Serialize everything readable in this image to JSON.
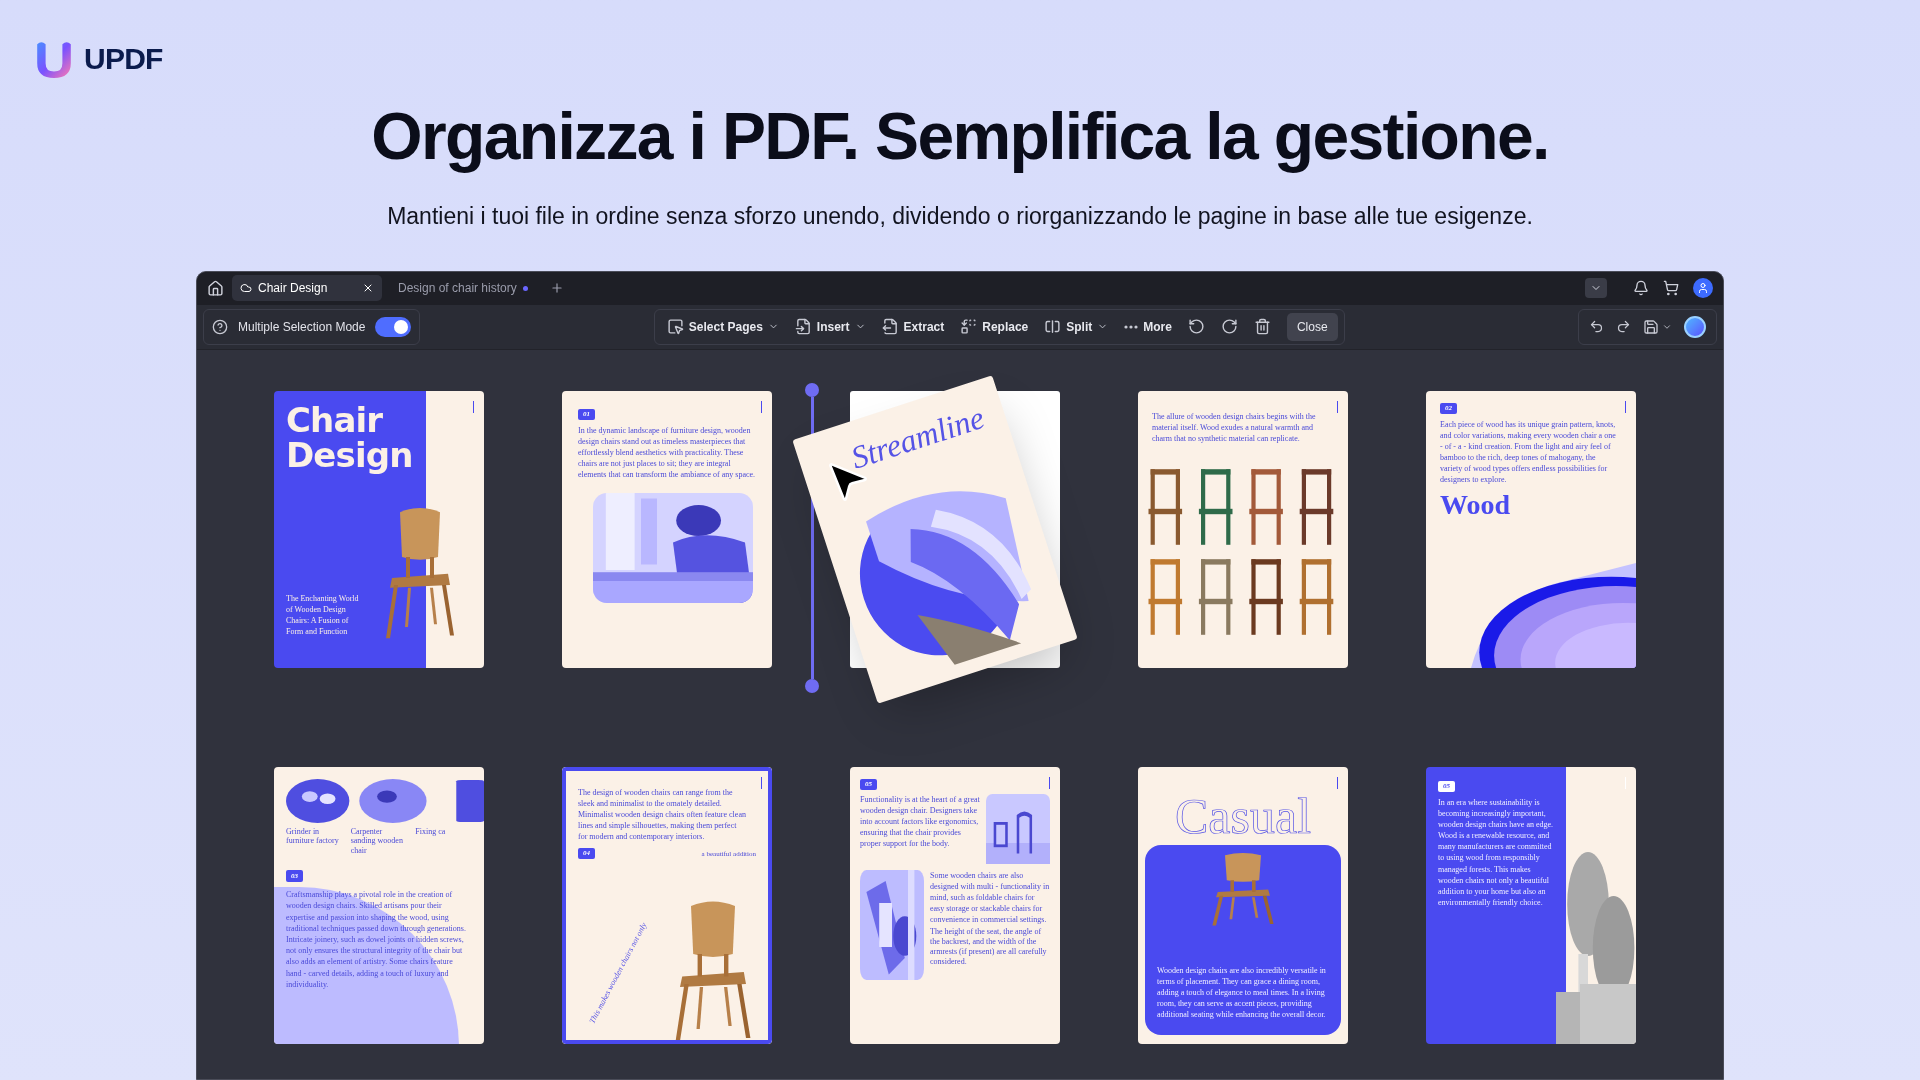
{
  "brand": {
    "name": "UPDF"
  },
  "headline": "Organizza i PDF. Semplifica la gestione.",
  "subtitle": "Mantieni i tuoi file in ordine senza sforzo unendo, dividendo o riorganizzando le pagine in base alle tue esigenze.",
  "tabs": [
    {
      "label": "Chair Design",
      "selected": true,
      "cloud": true,
      "unsaved": false
    },
    {
      "label": "Design of chair history",
      "selected": false,
      "cloud": false,
      "unsaved": true
    }
  ],
  "multi_select": {
    "label": "Multiple Selection Mode",
    "on": true
  },
  "tools": [
    {
      "label": "Select Pages",
      "dropdown": true
    },
    {
      "label": "Insert",
      "dropdown": true
    },
    {
      "label": "Extract",
      "dropdown": false
    },
    {
      "label": "Replace",
      "dropdown": false
    },
    {
      "label": "Split",
      "dropdown": true
    },
    {
      "label": "More",
      "dropdown": false
    }
  ],
  "close_label": "Close",
  "pages": [
    {
      "kind": "cover",
      "selected": false,
      "title": [
        "Chair",
        "Design"
      ],
      "text": "The Enchanting World of Wooden Design Chairs: A Fusion of Form and Function"
    },
    {
      "kind": "intro",
      "selected": false,
      "badge": "01",
      "text": "In the dynamic landscape of furniture design, wooden design chairs stand out as timeless masterpieces that effortlessly blend aesthetics with practicality. These chairs are not just places to sit; they are integral elements that can transform the ambiance of any space."
    },
    {
      "kind": "dragged",
      "selected": false,
      "title": "Streamline"
    },
    {
      "kind": "gallery",
      "selected": false,
      "text": "The allure of wooden design chairs begins with the material itself. Wood exudes a natural warmth and charm that no synthetic material can replicate."
    },
    {
      "kind": "wood",
      "selected": false,
      "badge": "02",
      "text": "Each piece of wood has its unique grain pattern, knots, and color variations, making every wooden chair a one - of - a - kind creation. From the light and airy feel of bamboo to the rich, deep tones of mahogany, the variety of wood types offers endless possibilities for designers to explore.",
      "title": "Wood"
    },
    {
      "kind": "craft",
      "selected": false,
      "captions": [
        "Grinder in furniture factory",
        "Carpenter sanding wooden chair",
        "Fixing ca"
      ],
      "badge": "03",
      "text": "Craftsmanship plays a pivotal role in the creation of wooden design chairs. Skilled artisans pour their expertise and passion into shaping the wood, using traditional techniques passed down through generations. Intricate joinery, such as dowel joints or hidden screws, not only ensures the structural integrity of the chair but also adds an element of artistry. Some chairs feature hand - carved details, adding a touch of luxury and individuality."
    },
    {
      "kind": "design",
      "selected": true,
      "text": "The design of wooden chairs can range from the sleek and minimalist to the ornately detailed. Minimalist wooden design chairs often feature clean lines and simple silhouettes, making them perfect for modern and contemporary interiors.",
      "badge": "04",
      "note": "a beautiful addition",
      "curve": "This makes wooden chairs not only"
    },
    {
      "kind": "function",
      "selected": false,
      "badge": "05",
      "text": "Functionality is at the heart of a great wooden design chair. Designers take into account factors like ergonomics, ensuring that the chair provides proper support for the body.",
      "text2": "Some wooden chairs are also designed with multi - functionality in mind, such as foldable chairs for easy storage or stackable chairs for convenience in commercial settings.",
      "note": "The height of the seat, the angle of the backrest, and the width of the armrests (if present) are all carefully considered."
    },
    {
      "kind": "casual",
      "selected": false,
      "title": "Casual",
      "text": "Wooden design chairs are also incredibly versatile in terms of placement. They can grace a dining room, adding a touch of elegance to meal times. In a living room, they can serve as accent pieces, providing additional seating while enhancing the overall decor."
    },
    {
      "kind": "eco",
      "selected": false,
      "badge": "05",
      "text": "In an era where sustainability is becoming increasingly important, wooden design chairs have an edge. Wood is a renewable resource, and many manufacturers are committed to using wood from responsibly managed forests. This makes wooden chairs not only a beautiful addition to your home but also an environmentally friendly choice."
    }
  ]
}
